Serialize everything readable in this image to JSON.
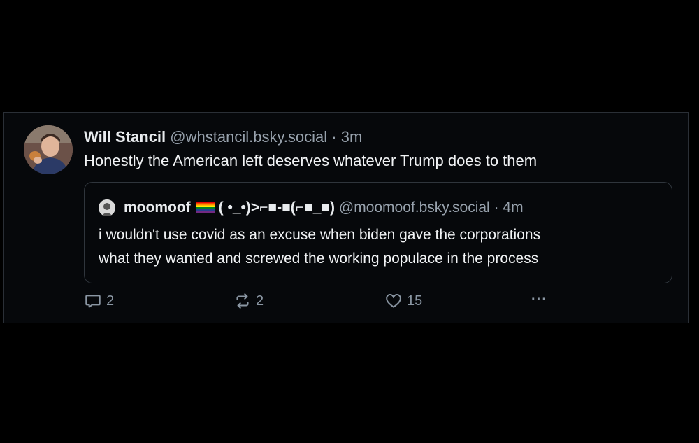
{
  "post": {
    "author_name": "Will Stancil",
    "author_handle": "@whstancil.bsky.social",
    "separator": "·",
    "time": "3m",
    "text": "Honestly the American left deserves whatever Trump does to them"
  },
  "quote": {
    "author_name": "moomoof",
    "name_suffix": "( •_•)>⌐■-■(⌐■_■)",
    "author_handle": "@moomoof.bsky.social",
    "separator": "·",
    "time": "4m",
    "line1": "i wouldn't use covid  as an excuse when biden gave the corporations",
    "line2": "what they wanted and screwed the working populace in the process"
  },
  "actions": {
    "reply_count": "2",
    "repost_count": "2",
    "like_count": "15",
    "more_label": "···"
  },
  "icons": {
    "reply": "reply-icon",
    "repost": "repost-icon",
    "like": "heart-icon",
    "more": "more-icon",
    "flag": "rainbow-flag-icon"
  },
  "colors": {
    "background": "#000000",
    "text": "#f1f3f5",
    "muted": "#98a2ad",
    "border": "#2f353c"
  }
}
